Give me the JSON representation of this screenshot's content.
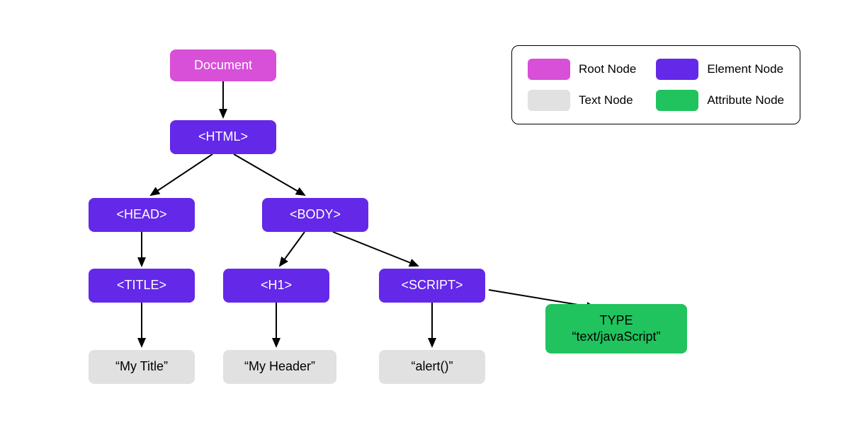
{
  "legend": {
    "root": "Root Node",
    "element": "Element Node",
    "text": "Text Node",
    "attribute": "Attribute Node"
  },
  "colors": {
    "root": "#D84FD8",
    "element": "#6428E8",
    "text": "#E1E1E1",
    "attribute": "#21C35E"
  },
  "nodes": {
    "document": "Document",
    "html": "<HTML>",
    "head": "<HEAD>",
    "body": "<BODY>",
    "title": "<TITLE>",
    "h1": "<H1>",
    "script": "<SCRIPT>",
    "titleText": "“My Title”",
    "headerText": "“My Header”",
    "alertText": "“alert()”",
    "attrType": "TYPE\n“text/javaScript”"
  },
  "tree": {
    "label": "Document",
    "type": "root",
    "children": [
      {
        "label": "<HTML>",
        "type": "element",
        "children": [
          {
            "label": "<HEAD>",
            "type": "element",
            "children": [
              {
                "label": "<TITLE>",
                "type": "element",
                "children": [
                  {
                    "label": "\"My Title\"",
                    "type": "text"
                  }
                ]
              }
            ]
          },
          {
            "label": "<BODY>",
            "type": "element",
            "children": [
              {
                "label": "<H1>",
                "type": "element",
                "children": [
                  {
                    "label": "\"My Header\"",
                    "type": "text"
                  }
                ]
              },
              {
                "label": "<SCRIPT>",
                "type": "element",
                "attributes": [
                  {
                    "label": "TYPE \"text/javaScript\"",
                    "type": "attribute"
                  }
                ],
                "children": [
                  {
                    "label": "\"alert()\"",
                    "type": "text"
                  }
                ]
              }
            ]
          }
        ]
      }
    ]
  }
}
